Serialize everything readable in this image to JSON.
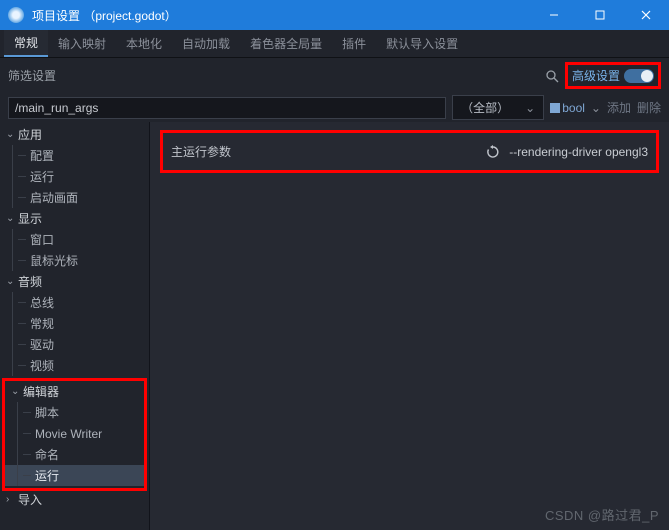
{
  "window": {
    "title": "项目设置 （project.godot）"
  },
  "tabs": [
    "常规",
    "输入映射",
    "本地化",
    "自动加载",
    "着色器全局量",
    "插件",
    "默认导入设置"
  ],
  "filter": {
    "label": "筛选设置",
    "advanced": "高级设置"
  },
  "pathbar": {
    "search": "/main_run_args",
    "dropdown": "（全部）",
    "booltype": "bool",
    "add": "添加",
    "del": "删除"
  },
  "tree": {
    "app": {
      "label": "应用",
      "children": [
        "配置",
        "运行",
        "启动画面"
      ]
    },
    "display": {
      "label": "显示",
      "children": [
        "窗口",
        "鼠标光标"
      ]
    },
    "audio": {
      "label": "音频",
      "children": [
        "总线",
        "常规",
        "驱动",
        "视频"
      ]
    },
    "editor": {
      "label": "编辑器",
      "children": [
        "脚本",
        "Movie Writer",
        "命名",
        "运行"
      ]
    },
    "import": {
      "label": "导入"
    }
  },
  "property": {
    "name": "主运行参数",
    "value": "--rendering-driver opengl3"
  },
  "watermark": "CSDN @路过君_P"
}
